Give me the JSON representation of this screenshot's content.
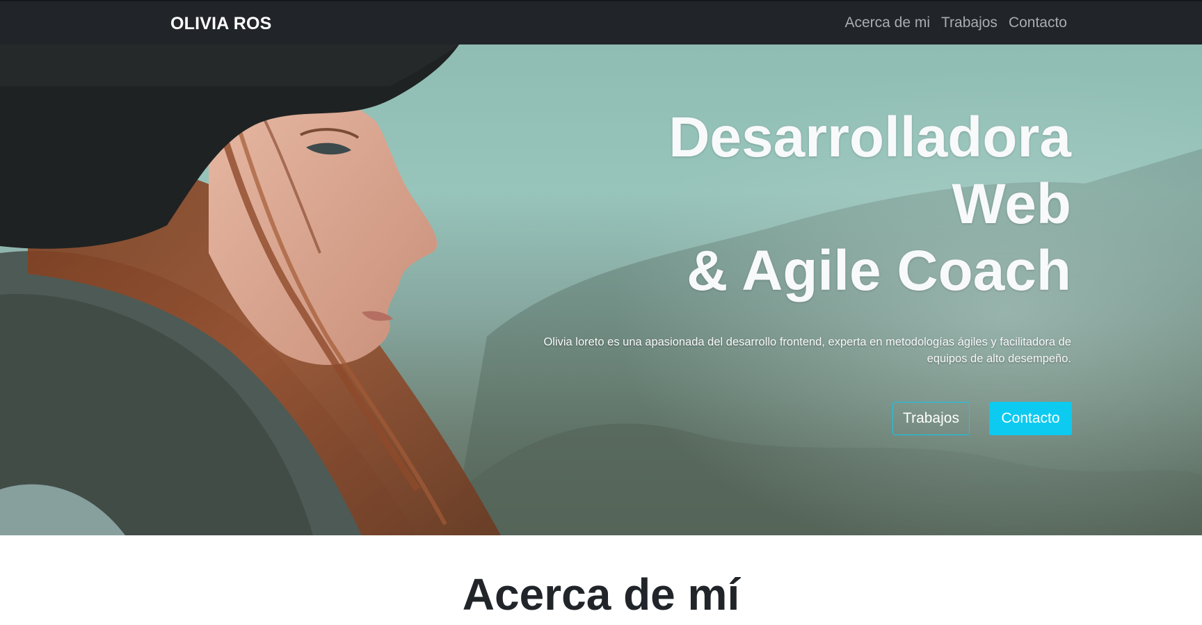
{
  "navbar": {
    "brand": "OLIVIA ROS",
    "links": [
      "Acerca de mi",
      "Trabajos",
      "Contacto"
    ]
  },
  "hero": {
    "title_lines": [
      "Desarrolladora",
      "Web",
      "& Agile Coach"
    ],
    "description": "Olivia loreto es una apasionada del desarrollo frontend, experta en metodologías ágiles y facilitadora de equipos de alto desempeño.",
    "buttons": {
      "works": "Trabajos",
      "contact": "Contacto"
    },
    "image": "portrait-photo"
  },
  "about": {
    "title": "Acerca de mí"
  },
  "colors": {
    "navbar_bg": "#212529",
    "accent": "#0dcaf0",
    "hero_text": "#f8f9fa"
  }
}
